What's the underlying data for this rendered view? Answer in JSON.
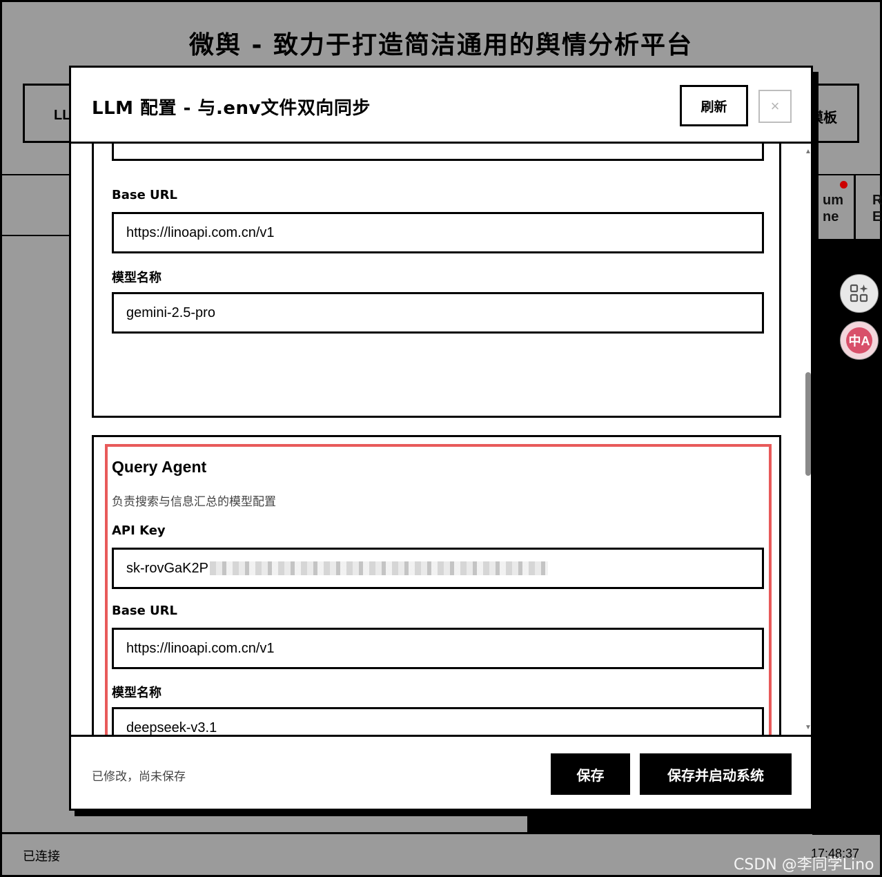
{
  "background": {
    "app_title": "微舆 - 致力于打造简洁通用的舆情分析平台",
    "left_tab_partial": "LL",
    "right_tab_partial": "模板",
    "engine_tab_a_line1": "um",
    "engine_tab_a_line2": "ne",
    "engine_tab_b_line1": "R",
    "engine_tab_b_line2": "E",
    "status": "已连接",
    "clock": "17:48:37",
    "watermark": "CSDN @李同学Lino"
  },
  "side_buttons": {
    "apps_icon": "apps-sparkle-icon",
    "translate_icon": "translate-icon",
    "translate_label": "中A"
  },
  "modal": {
    "title": "LLM 配置 - 与.env文件双向同步",
    "refresh_label": "刷新",
    "close_label": "×",
    "sections": {
      "previous_agent": {
        "base_url_label": "Base URL",
        "base_url_value": "https://linoapi.com.cn/v1",
        "model_label": "模型名称",
        "model_value": "gemini-2.5-pro"
      },
      "query_agent": {
        "title": "Query Agent",
        "description": "负责搜索与信息汇总的模型配置",
        "api_key_label": "API Key",
        "api_key_value": "sk-rovGaK2P",
        "base_url_label": "Base URL",
        "base_url_value": "https://linoapi.com.cn/v1",
        "model_label": "模型名称",
        "model_value": "deepseek-v3.1"
      }
    },
    "footer": {
      "status": "已修改，尚未保存",
      "save_label": "保存",
      "save_start_label": "保存并启动系统"
    }
  },
  "colors": {
    "highlight": "#e85a5a",
    "overlay": "#9b9b9b"
  }
}
